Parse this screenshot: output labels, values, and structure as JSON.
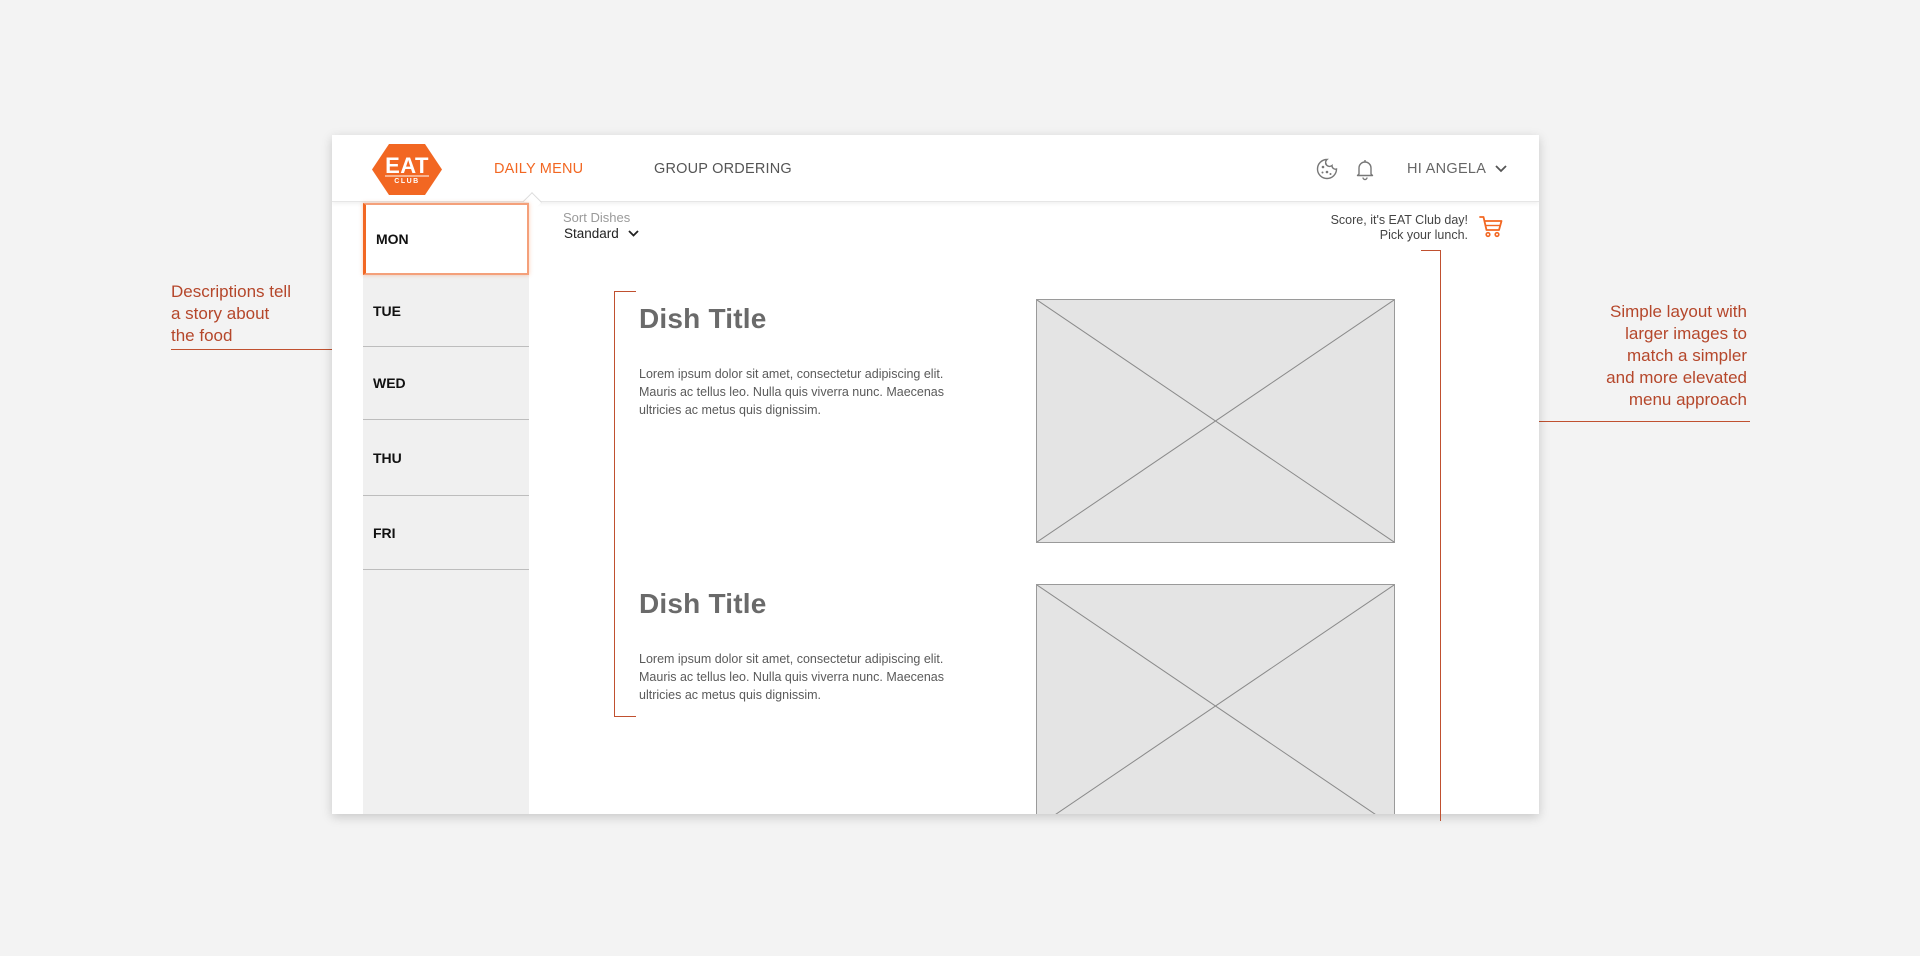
{
  "header": {
    "logo": {
      "main": "EAT",
      "sub": "CLUB"
    },
    "nav": [
      {
        "label": "DAILY MENU",
        "active": true
      },
      {
        "label": "GROUP ORDERING",
        "active": false
      }
    ],
    "icons": [
      "cookie-icon",
      "bell-icon",
      "chevron-down-icon"
    ],
    "user_greeting": "HI ANGELA"
  },
  "sidebar": {
    "days": [
      "MON",
      "TUE",
      "WED",
      "THU",
      "FRI"
    ],
    "active_day": "MON"
  },
  "sort": {
    "label": "Sort Dishes",
    "value": "Standard"
  },
  "promo": {
    "line1": "Score, it's EAT Club day!",
    "line2": "Pick your lunch."
  },
  "dishes": [
    {
      "title": "Dish Title",
      "description": "Lorem ipsum dolor sit amet, consectetur adipiscing elit. Mauris ac tellus leo. Nulla quis viverra nunc. Maecenas ultricies ac metus quis dignissim."
    },
    {
      "title": "Dish Title",
      "description": "Lorem ipsum dolor sit amet, consectetur adipiscing elit. Mauris ac tellus leo. Nulla quis viverra nunc. Maecenas ultricies ac metus quis dignissim."
    }
  ],
  "annotations": {
    "left": [
      "Descriptions tell",
      "a story about",
      "the food"
    ],
    "right": [
      "Simple layout with",
      "larger images to",
      "match a simpler",
      "and more elevated",
      "menu approach"
    ]
  },
  "colors": {
    "brand": "#f26722",
    "annotation": "#b5472b",
    "background": "#f3f3f3"
  }
}
